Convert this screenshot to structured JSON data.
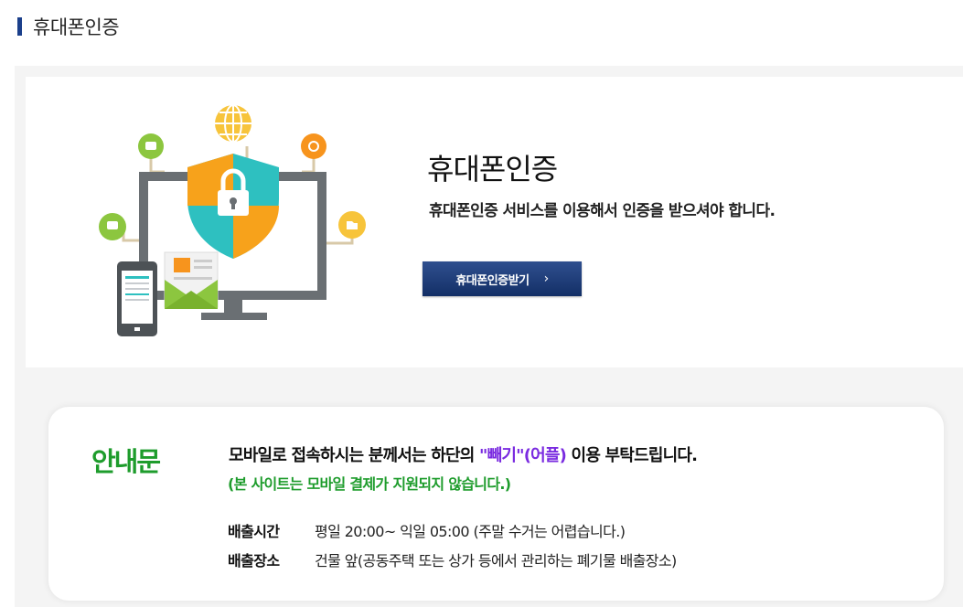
{
  "header": {
    "title": "휴대폰인증"
  },
  "auth": {
    "title": "휴대폰인증",
    "description": "휴대폰인증 서비스를 이용해서 인증을 받으셔야 합니다.",
    "button_label": "휴대폰인증받기",
    "button_chevron": "›"
  },
  "notice": {
    "label": "안내문",
    "line1_pre": "모바일로 접속하시는 분께서는 하단의 ",
    "line1_highlight": "\"빼기\"(어플)",
    "line1_post": " 이용 부탁드립니다.",
    "line2": "(본 사이트는 모바일 결제가 지원되지 않습니다.)",
    "rows": [
      {
        "label": "배출시간",
        "value": "평일 20:00~ 익일 05:00 (주말 수거는 어렵습니다.)"
      },
      {
        "label": "배출장소",
        "value": "건물 앞(공동주택 또는 상가 등에서 관리하는 폐기물 배출장소)"
      }
    ]
  },
  "colors": {
    "accent_navy": "#1b3f8b",
    "notice_green": "#1e9c2c",
    "highlight_purple": "#7a2be0"
  },
  "icons": {
    "illustration": "security-shield-monitor-illustration"
  }
}
